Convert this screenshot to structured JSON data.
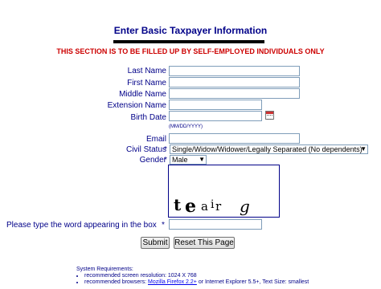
{
  "header": {
    "title": "Enter Basic Taxpayer Information",
    "warning": "THIS SECTION IS TO BE FILLED UP BY SELF-EMPLOYED INDIVIDUALS ONLY"
  },
  "form": {
    "required_marker": "*",
    "last_name": {
      "label": "Last Name",
      "value": ""
    },
    "first_name": {
      "label": "First Name",
      "value": ""
    },
    "middle_name": {
      "label": "Middle Name",
      "value": ""
    },
    "extension_name": {
      "label": "Extension Name",
      "value": ""
    },
    "birth_date": {
      "label": "Birth Date",
      "value": "",
      "hint": "(MM/DD/YYYY)"
    },
    "email": {
      "label": "Email",
      "value": ""
    },
    "civil_status": {
      "label": "Civil Status",
      "selected": "Single/Widow/Widower/Legally Separated (No dependents)"
    },
    "gender": {
      "label": "Gender",
      "selected": "Male"
    },
    "captcha": {
      "label": "Please type the word appearing in the box",
      "word": "teair g",
      "value": ""
    }
  },
  "buttons": {
    "submit": "Submit",
    "reset": "Reset This Page"
  },
  "system_requirements": {
    "heading": "System Requirements:",
    "resolution": "recommended screen resolution: 1024 X 768",
    "browsers_prefix": "recommended browsers: ",
    "browser_link": "Mozilla Firefox 2.2+",
    "browsers_suffix": " or Internet Explorer 5.5+, Text Size: smallest"
  },
  "colors": {
    "label": "#000088",
    "warning": "#cc0000",
    "border": "#7f9db9"
  },
  "icons": {
    "calendar": "calendar-icon",
    "dropdown": "chevron-down-icon"
  }
}
